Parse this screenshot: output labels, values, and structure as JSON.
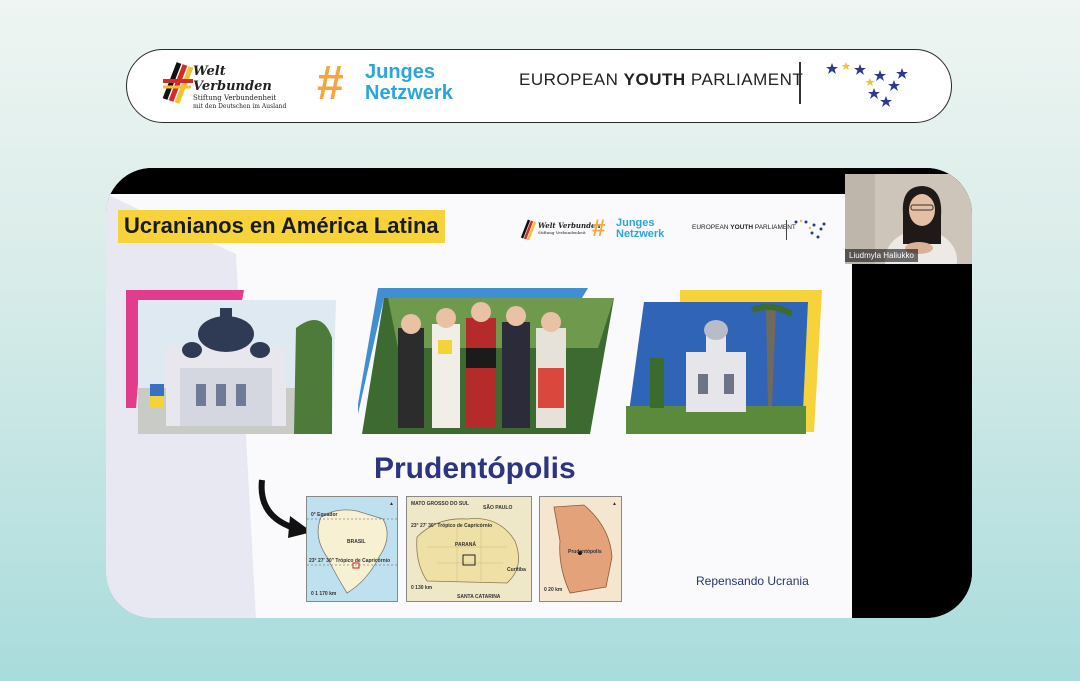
{
  "banner": {
    "welt_title": "Welt Verbunden",
    "welt_subtitle": "Stiftung Verbundenheit",
    "welt_subtitle2": "mit den Deutschen im Ausland",
    "jn_hash": "#",
    "jn_line1": "Junges",
    "jn_line2": "Netzwerk",
    "eyp_pre": "EUROPEAN ",
    "eyp_bold": "YOUTH",
    "eyp_post": " PARLIAMENT"
  },
  "slide": {
    "title": "Ucranianos en América Latina",
    "place": "Prudentópolis",
    "footer": "Repensando Ucrania",
    "mini_welt": "Welt Verbunden",
    "mini_welt_sub": "Stiftung Verbundenheit",
    "mini_jn1": "Junges",
    "mini_jn2": "Netzwerk",
    "mini_eyp_pre": "EUROPEAN ",
    "mini_eyp_bold": "YOUTH",
    "mini_eyp_post": " PARLIAMENT",
    "maps": {
      "m1_equator": "0° Equador",
      "m1_brasil": "BRASIL",
      "m1_tropic": "23° 27' 30\" Trópico de Capricórnio",
      "m1_scale": "0  1 170 km",
      "m2_mgs": "MATO GROSSO DO SUL",
      "m2_sp": "SÃO PAULO",
      "m2_tropic": "23° 27' 30\" Trópico de Capricórnio",
      "m2_parana": "PARANÁ",
      "m2_curitiba": "Curitiba",
      "m2_scale": "0  130 km",
      "m2_sc": "SANTA CATARINA",
      "m3_place": "Prudentópolis",
      "m3_scale": "0  20 km"
    }
  },
  "participant": {
    "name": "Liudmyla Haliukko"
  },
  "colors": {
    "accent_yellow": "#f6d33b",
    "accent_pink": "#e23d8c",
    "accent_blue": "#3f8fd2",
    "title_navy": "#2b3580",
    "jn_orange": "#f3a640",
    "jn_blue": "#2aa6d8"
  },
  "icons": [
    "welt-verbunden-logo-icon",
    "eyp-stars-icon",
    "curved-arrow-icon",
    "north-arrow-icon"
  ]
}
